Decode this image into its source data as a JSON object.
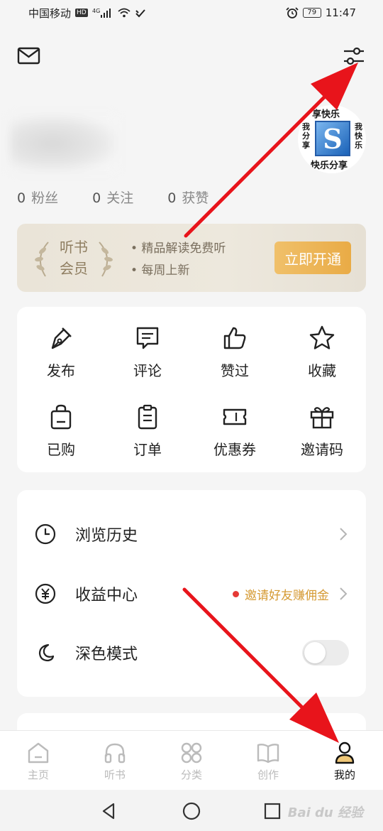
{
  "status_bar": {
    "carrier": "中国移动",
    "hd_tag": "HD",
    "net_tag": "4G",
    "battery": "79",
    "time": "11:47"
  },
  "header": {
    "mail_icon": "mail-icon",
    "settings_icon": "sliders-icon"
  },
  "profile": {
    "avatar": {
      "top": "享快乐",
      "left": "我分享",
      "right": "我快乐",
      "bottom": "快乐分享",
      "logo": "S"
    },
    "stats": [
      {
        "value": "0",
        "label": "粉丝"
      },
      {
        "value": "0",
        "label": "关注"
      },
      {
        "value": "0",
        "label": "获赞"
      }
    ]
  },
  "vip": {
    "badge_line1": "听书",
    "badge_line2": "会员",
    "benefit1": "• 精品解读免费听",
    "benefit2": "• 每周上新",
    "button": "立即开通"
  },
  "grid": [
    {
      "label": "发布",
      "icon": "pen-icon"
    },
    {
      "label": "评论",
      "icon": "comment-icon"
    },
    {
      "label": "赞过",
      "icon": "thumbs-up-icon"
    },
    {
      "label": "收藏",
      "icon": "star-icon"
    },
    {
      "label": "已购",
      "icon": "bag-icon"
    },
    {
      "label": "订单",
      "icon": "clipboard-icon"
    },
    {
      "label": "优惠券",
      "icon": "ticket-icon"
    },
    {
      "label": "邀请码",
      "icon": "gift-icon"
    }
  ],
  "menu": {
    "history": "浏览历史",
    "earnings": "收益中心",
    "earnings_promo": "邀请好友赚佣金",
    "dark_mode": "深色模式",
    "dark_mode_on": false
  },
  "tabs": [
    {
      "label": "主页",
      "icon": "home-icon",
      "active": false
    },
    {
      "label": "听书",
      "icon": "headphones-icon",
      "active": false
    },
    {
      "label": "分类",
      "icon": "grid-icon",
      "active": false
    },
    {
      "label": "创作",
      "icon": "book-icon",
      "active": false
    },
    {
      "label": "我的",
      "icon": "user-icon",
      "active": true
    }
  ],
  "watermark": "Bai du 经验",
  "colors": {
    "accent": "#e9ab46",
    "promo_text": "#d59a33",
    "arrow": "#e8141b"
  }
}
